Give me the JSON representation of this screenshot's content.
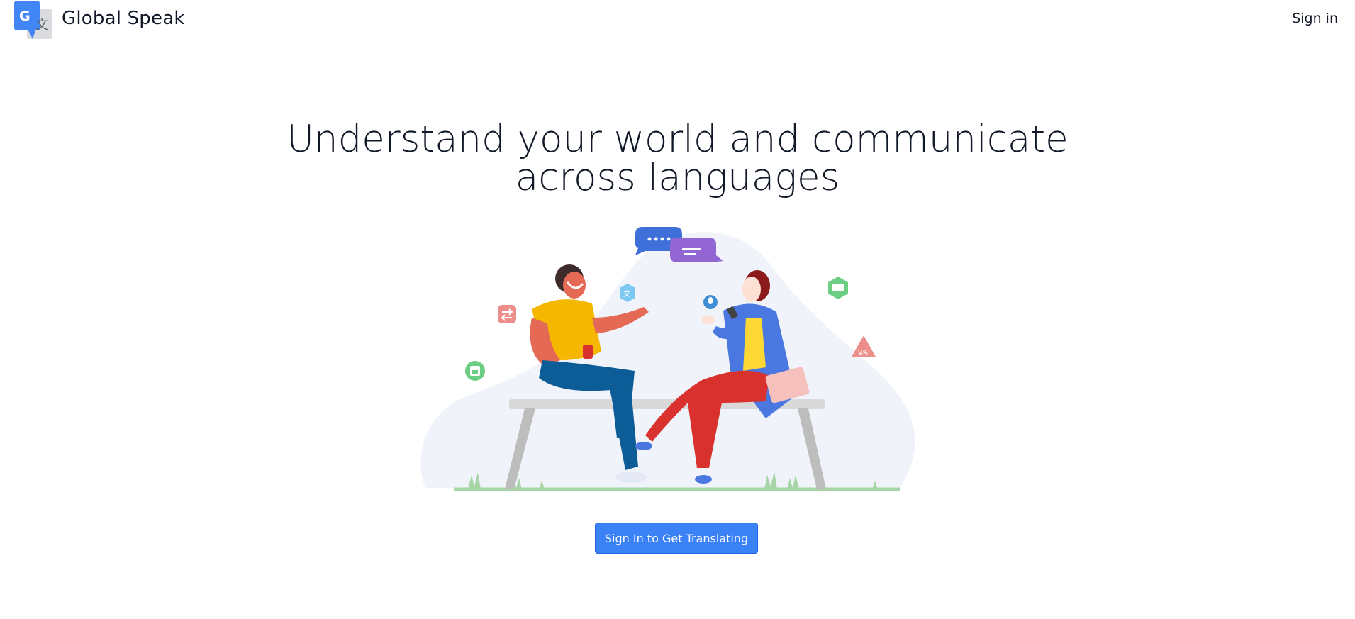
{
  "header": {
    "brand": "Global Speak",
    "signin_label": "Sign in",
    "logo_icon": "translate-logo-icon",
    "logo_letters": [
      "G",
      "文"
    ]
  },
  "hero": {
    "title_line1": "Understand your world and communicate",
    "title_line2": "across languages",
    "illustration": "two-people-conversing-illustration",
    "cta_label": "Sign In to Get Translating"
  },
  "colors": {
    "accent": "#3b82f6",
    "logo_blue": "#4285f4",
    "logo_gray": "#dadce0",
    "text": "#111827",
    "border": "#e5e7eb"
  }
}
